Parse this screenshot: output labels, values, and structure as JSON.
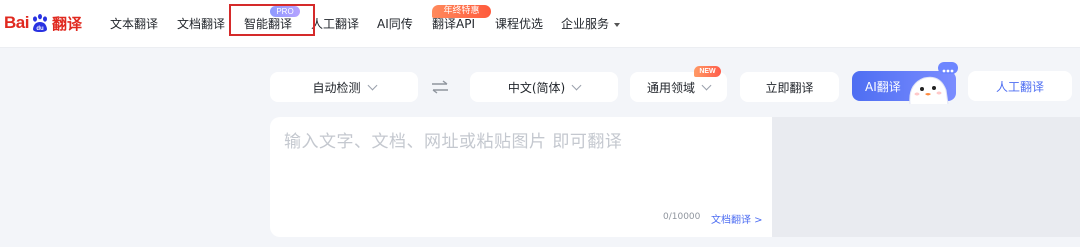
{
  "brand": {
    "logo_bai": "Bai",
    "logo_du": "du",
    "logo_suffix": "翻译",
    "brand_red": "#e0291f"
  },
  "nav": {
    "items": [
      {
        "label": "文本翻译"
      },
      {
        "label": "文档翻译"
      },
      {
        "label": "智能翻译",
        "badge": "PRO",
        "selected": true
      },
      {
        "label": "人工翻译"
      },
      {
        "label": "AI同传"
      },
      {
        "label": "翻译API",
        "badge": "年终特惠"
      },
      {
        "label": "课程优选"
      },
      {
        "label": "企业服务",
        "has_dropdown": true
      }
    ],
    "highlight_color": "#d52a2a"
  },
  "toolbar": {
    "source_lang": "自动检测",
    "target_lang": "中文(简体)",
    "domain": "通用领域",
    "domain_badge": "NEW",
    "translate_now": "立即翻译",
    "ai_translate": "AI翻译",
    "human_translate": "人工翻译",
    "accent": "#4e6ef2"
  },
  "input": {
    "placeholder": "输入文字、文档、网址或粘贴图片 即可翻译",
    "char_count": "0/10000",
    "doc_link": "文档翻译 >"
  },
  "icons": [
    "swap-languages-icon",
    "chevron-down-icon",
    "mascot-icon",
    "chat-dots-icon",
    "caret-down-icon"
  ]
}
